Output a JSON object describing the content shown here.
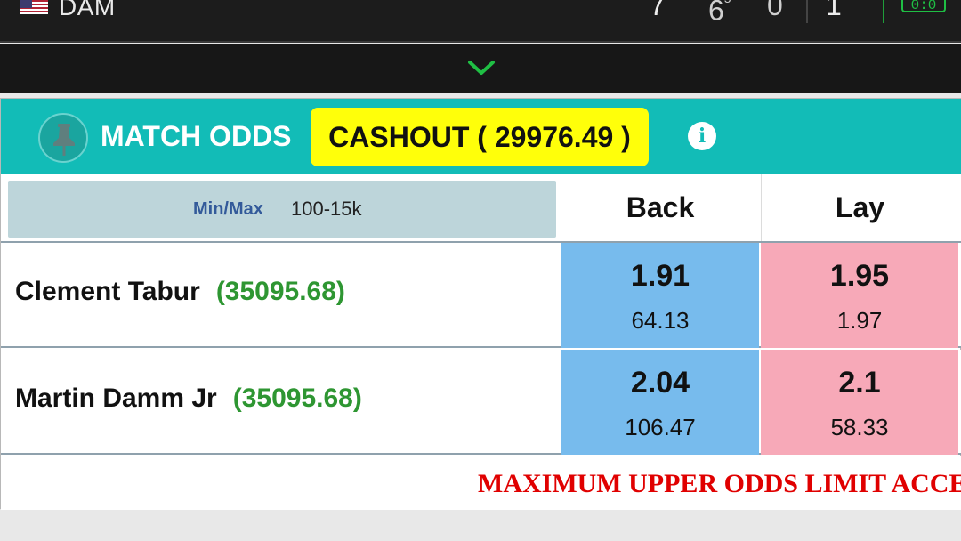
{
  "scoreboard": {
    "team_name": "DAM",
    "score_1": "7",
    "score_2": "6",
    "score_2_sup": "5",
    "score_3": "0",
    "score_4": "1",
    "live_badge": "0:0"
  },
  "market": {
    "title": "MATCH ODDS",
    "cashout_label": "CASHOUT ( 29976.49 )",
    "info_icon": "i",
    "minmax_label": "Min/Max",
    "minmax_value": "100-15k",
    "back_header": "Back",
    "lay_header": "Lay",
    "runners": [
      {
        "name": "Clement Tabur",
        "position": "(35095.68)",
        "back_price": "1.91",
        "back_size": "64.13",
        "lay_price": "1.95",
        "lay_size": "1.97"
      },
      {
        "name": "Martin Damm Jr",
        "position": "(35095.68)",
        "back_price": "2.04",
        "back_size": "106.47",
        "lay_price": "2.1",
        "lay_size": "58.33"
      }
    ],
    "notice": "MAXIMUM UPPER ODDS LIMIT ACCE"
  },
  "colors": {
    "header_teal": "#12bcb7",
    "cashout_yellow": "#ffff0a",
    "back_blue": "#77bbed",
    "lay_pink": "#f7a9b8",
    "position_green": "#2e9632",
    "notice_red": "#e00000"
  },
  "icons": {
    "flag": "us-flag-icon",
    "chevron": "chevron-down-icon",
    "pin": "pin-icon",
    "info": "info-icon"
  }
}
